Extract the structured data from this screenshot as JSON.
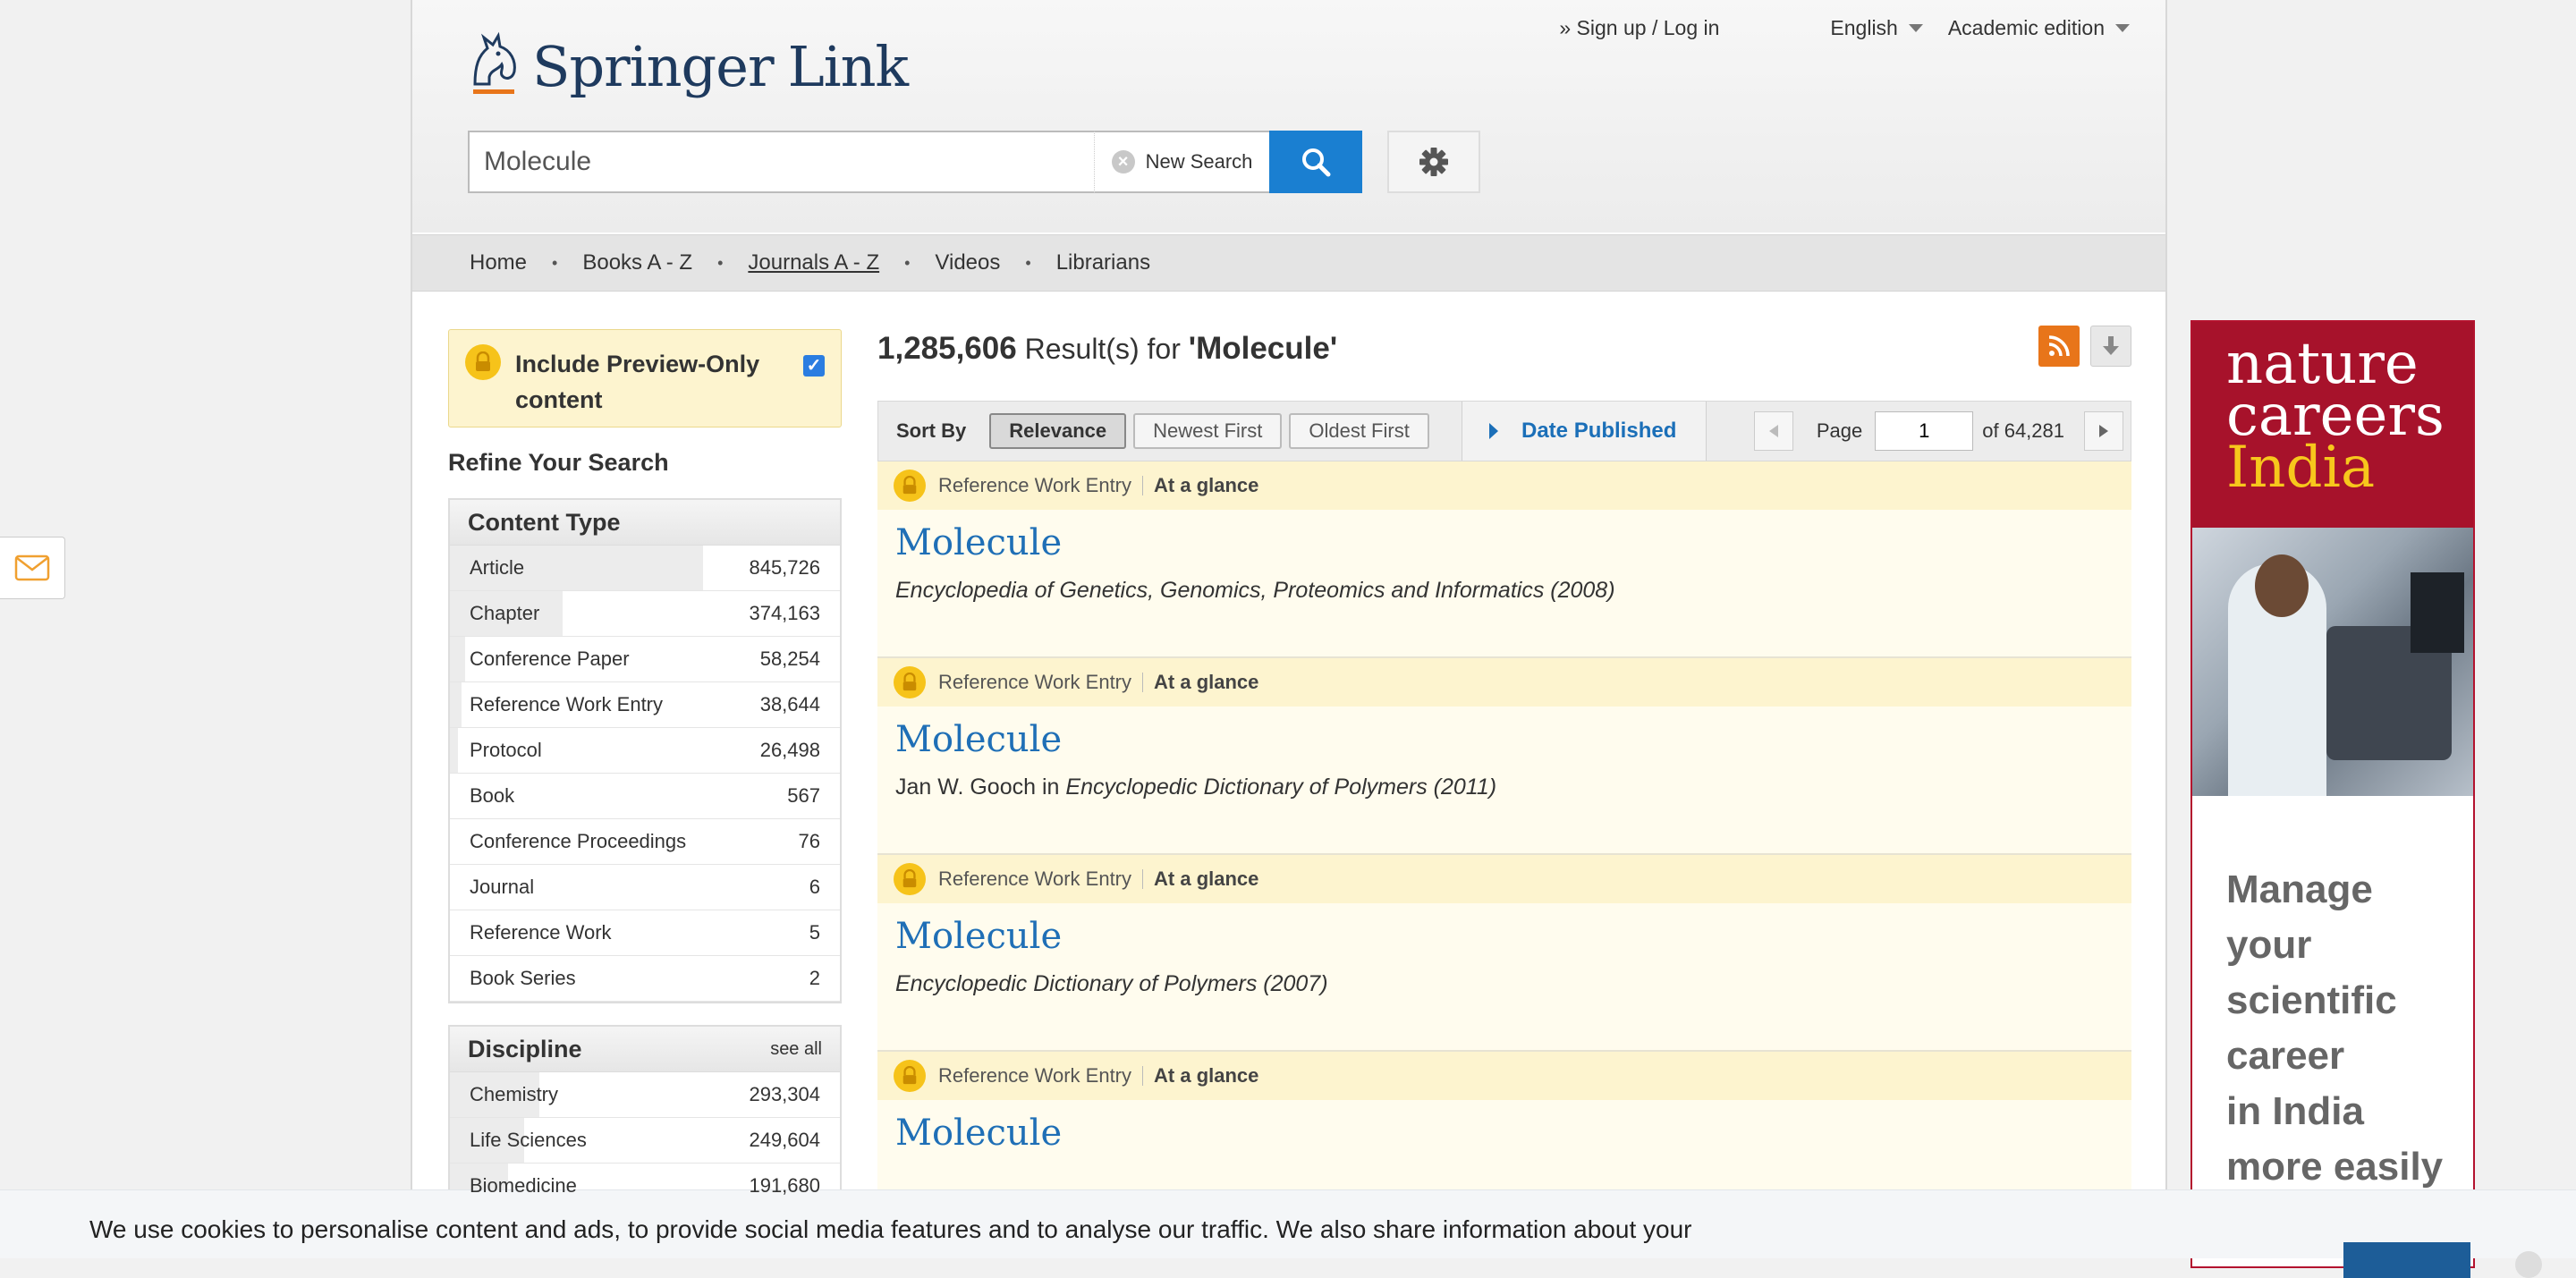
{
  "header": {
    "logo_text": "Springer",
    "logo_link": "Link",
    "signup": "» Sign up / Log in",
    "language": "English",
    "edition": "Academic edition"
  },
  "search": {
    "value": "Molecule",
    "new_search": "New Search"
  },
  "nav": [
    "Home",
    "Books A - Z",
    "Journals A - Z",
    "Videos",
    "Librarians"
  ],
  "sidebar": {
    "preview_label": "Include Preview-Only content",
    "refine_title": "Refine Your Search",
    "content_type": {
      "title": "Content Type",
      "items": [
        {
          "label": "Article",
          "count": "845,726",
          "share": 0.65
        },
        {
          "label": "Chapter",
          "count": "374,163",
          "share": 0.29
        },
        {
          "label": "Conference Paper",
          "count": "58,254",
          "share": 0.04
        },
        {
          "label": "Reference Work Entry",
          "count": "38,644",
          "share": 0.03
        },
        {
          "label": "Protocol",
          "count": "26,498",
          "share": 0.02
        },
        {
          "label": "Book",
          "count": "567",
          "share": 0
        },
        {
          "label": "Conference Proceedings",
          "count": "76",
          "share": 0
        },
        {
          "label": "Journal",
          "count": "6",
          "share": 0
        },
        {
          "label": "Reference Work",
          "count": "5",
          "share": 0
        },
        {
          "label": "Book Series",
          "count": "2",
          "share": 0
        }
      ]
    },
    "discipline": {
      "title": "Discipline",
      "see_all": "see all",
      "items": [
        {
          "label": "Chemistry",
          "count": "293,304",
          "share": 0.23
        },
        {
          "label": "Life Sciences",
          "count": "249,604",
          "share": 0.19
        },
        {
          "label": "Biomedicine",
          "count": "191,680",
          "share": 0.15
        }
      ]
    }
  },
  "results": {
    "count": "1,285,606",
    "label": "Result(s) for",
    "query": "'Molecule'",
    "sort_label": "Sort By",
    "sort_options": [
      "Relevance",
      "Newest First",
      "Oldest First"
    ],
    "date_published": "Date Published",
    "page_label": "Page",
    "page_value": "1",
    "page_of": "of 64,281",
    "items": [
      {
        "type": "Reference Work Entry",
        "glance": "At a glance",
        "title": "Molecule",
        "author": "",
        "source": "Encyclopedia of Genetics, Genomics, Proteomics and Informatics (2008)"
      },
      {
        "type": "Reference Work Entry",
        "glance": "At a glance",
        "title": "Molecule",
        "author": "Jan W. Gooch in",
        "source": "Encyclopedic Dictionary of Polymers (2011)"
      },
      {
        "type": "Reference Work Entry",
        "glance": "At a glance",
        "title": "Molecule",
        "author": "",
        "source": "Encyclopedic Dictionary of Polymers (2007)"
      },
      {
        "type": "Reference Work Entry",
        "glance": "At a glance",
        "title": "Molecule",
        "author": "",
        "source": ""
      }
    ]
  },
  "ad": {
    "line1": "nature",
    "line2": "careers",
    "line3": "India",
    "body": [
      "Manage",
      "your",
      "scientific",
      "career",
      "in India",
      "more easily"
    ]
  },
  "cookie": {
    "text": "We use cookies to personalise content and ads, to provide social media features and to analyse our traffic. We also share information about your"
  },
  "colors": {
    "accent": "#1a7fd1",
    "link": "#1f6fb6",
    "rss": "#e8751a",
    "ad_red": "#a7122b",
    "ad_yellow": "#f7c71c"
  }
}
